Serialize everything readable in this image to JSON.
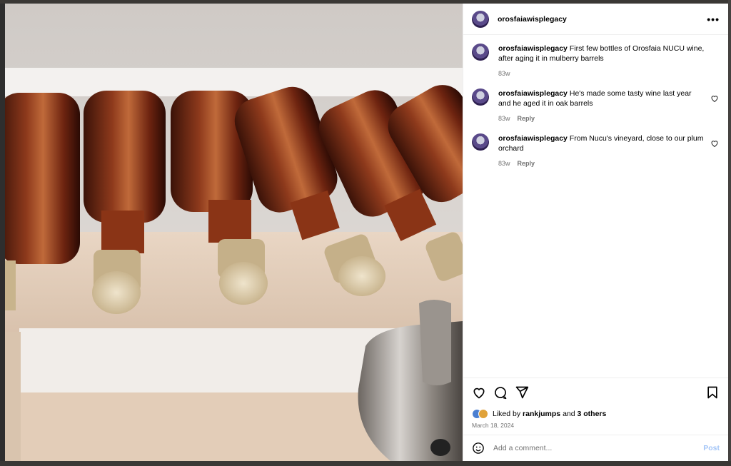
{
  "post": {
    "username": "orosfaiawisplegacy",
    "more_label": "•••",
    "comments": [
      {
        "username": "orosfaiawisplegacy",
        "text": "First few bottles of Orosfaia NUCU wine, after aging it in mulberry barrels",
        "age": "83w",
        "reply": ""
      },
      {
        "username": "orosfaiawisplegacy",
        "text": "He's made some tasty wine last year and he aged it in oak barrels",
        "age": "83w",
        "reply": "Reply"
      },
      {
        "username": "orosfaiawisplegacy",
        "text": "From Nucu's vineyard, close to our plum orchard",
        "age": "83w",
        "reply": "Reply"
      }
    ],
    "likes": {
      "prefix": "Liked by",
      "user": "rankjumps",
      "conj": "and",
      "others": "3 others"
    },
    "date": "March 18, 2024",
    "add_comment_placeholder": "Add a comment...",
    "post_label": "Post"
  },
  "icons": [
    "more-icon",
    "heart-icon",
    "comment-icon",
    "share-icon",
    "bookmark-icon",
    "emoji-icon"
  ],
  "colors": {
    "post_button": "#a3c5f7",
    "meta_text": "#737373"
  }
}
